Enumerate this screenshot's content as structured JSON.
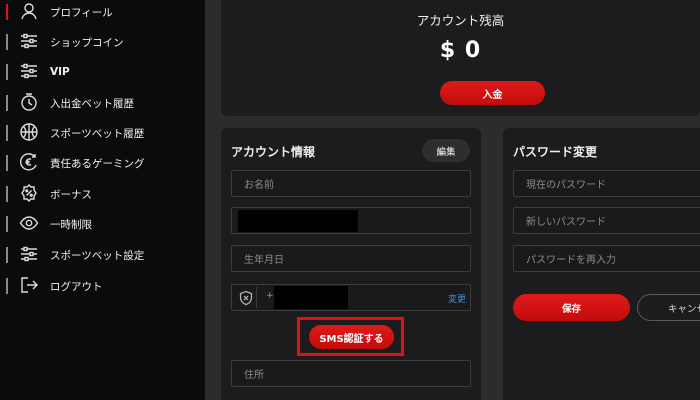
{
  "sidebar": {
    "items": [
      {
        "label": "プロフィール",
        "icon": "user-icon"
      },
      {
        "label": "ショップコイン",
        "icon": "sliders-icon"
      },
      {
        "label": "VIP",
        "icon": "sliders-icon"
      },
      {
        "label": "入出金ベット履歴",
        "icon": "history-icon"
      },
      {
        "label": "スポーツベット履歴",
        "icon": "basketball-icon"
      },
      {
        "label": "責任あるゲーミング",
        "icon": "euro-cycle-icon"
      },
      {
        "label": "ボーナス",
        "icon": "percent-badge-icon"
      },
      {
        "label": "一時制限",
        "icon": "eye-icon"
      },
      {
        "label": "スポーツベット設定",
        "icon": "sliders-icon"
      },
      {
        "label": "ログアウト",
        "icon": "logout-icon"
      }
    ]
  },
  "balance": {
    "title": "アカウント残高",
    "amount": "$ 0",
    "deposit_label": "入金"
  },
  "account": {
    "title": "アカウント情報",
    "edit_label": "編集",
    "name_placeholder": "お名前",
    "birthdate_placeholder": "生年月日",
    "phone_prefix": "+",
    "change_label": "変更",
    "sms_label": "SMS認証する",
    "address_placeholder": "住所"
  },
  "password": {
    "title": "パスワード変更",
    "current_placeholder": "現在のパスワード",
    "new_placeholder": "新しいパスワード",
    "confirm_placeholder": "パスワードを再入力",
    "save_label": "保存",
    "cancel_label": "キャンセル"
  },
  "colors": {
    "accent_red": "#d41414",
    "highlight_border": "#e01111",
    "link_blue": "#3d8fe0",
    "sidebar_bg": "#0b0b0b",
    "card_bg": "#1c1c1e"
  }
}
